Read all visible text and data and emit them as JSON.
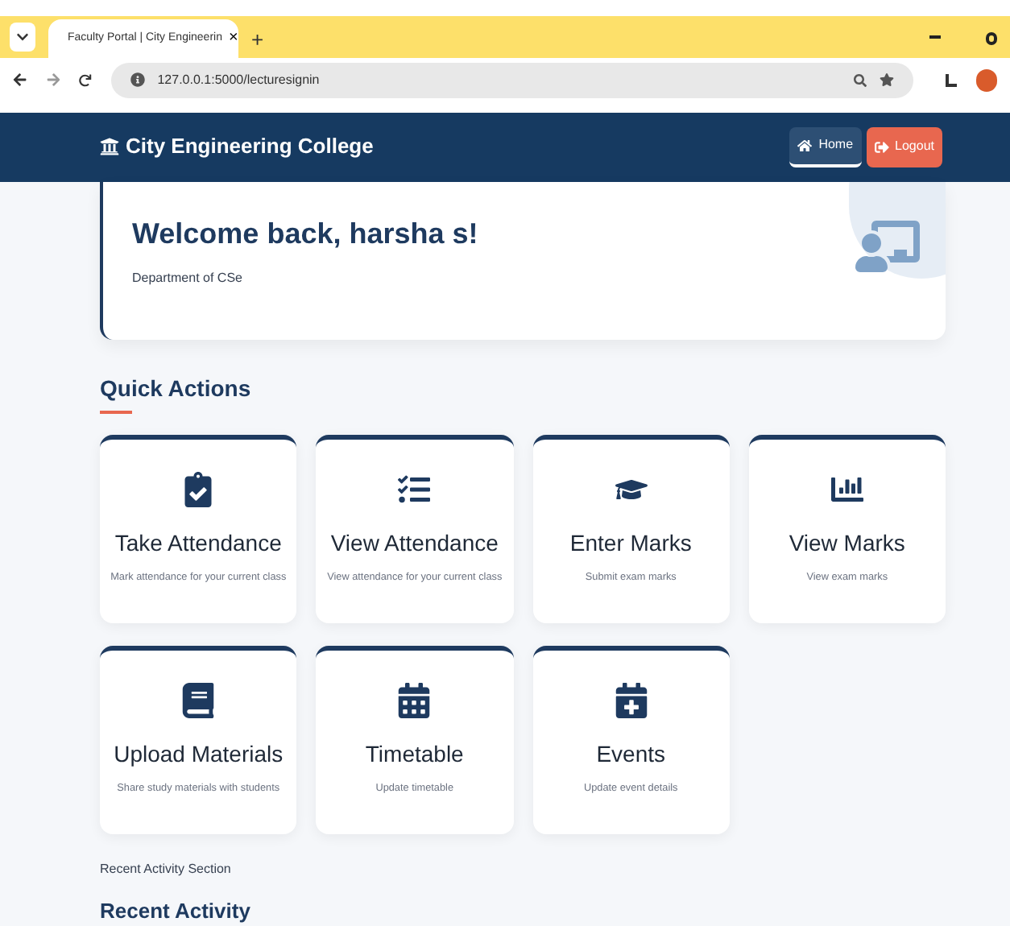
{
  "browser": {
    "tab_title": "Faculty Portal | City Engineerin",
    "tab_close": "×",
    "new_tab": "+",
    "url": "127.0.0.1:5000/lecturesignin"
  },
  "navbar": {
    "brand": "City Engineering College",
    "buttons": [
      {
        "label": "Home",
        "kind": "home",
        "selected": true
      },
      {
        "label": "Logout",
        "kind": "logout",
        "selected": false
      }
    ]
  },
  "welcome": {
    "title": "Welcome back, harsha s!",
    "subtitle": "Department of CSe"
  },
  "quick_actions": {
    "title": "Quick Actions",
    "items": [
      {
        "kind": "clipboard",
        "title": "Take Attendance",
        "description": "Mark attendance for your current class"
      },
      {
        "kind": "checklist",
        "title": "View Attendance",
        "description": "View attendance for your current class"
      },
      {
        "kind": "cap",
        "title": "Enter Marks",
        "description": "Submit exam marks"
      },
      {
        "kind": "chart",
        "title": "View Marks",
        "description": "View exam marks"
      },
      {
        "kind": "book",
        "title": "Upload Materials",
        "description": "Share study materials with students"
      },
      {
        "kind": "calendar",
        "title": "Timetable",
        "description": "Update timetable"
      },
      {
        "kind": "calendar_plus",
        "title": "Events",
        "description": "Update event details"
      }
    ]
  },
  "recent_note": "Recent Activity Section",
  "recent_title": "Recent Activity"
}
